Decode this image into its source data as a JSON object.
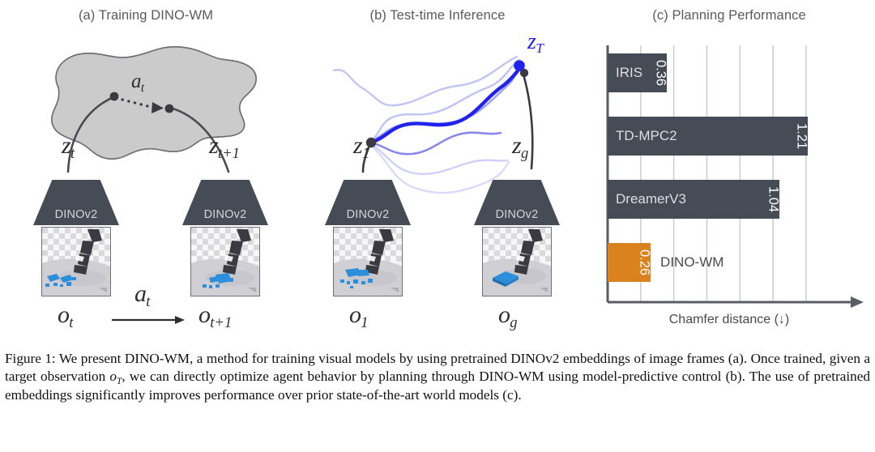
{
  "figure": {
    "caption_label": "Figure 1:",
    "caption_part1": " We present DINO-WM, a method for training visual models by using pretrained DINOv2 embeddings of image frames (a). Once trained, given a target observation ",
    "caption_math_base": "o",
    "caption_math_sub": "T",
    "caption_part2": ", we can directly optimize agent behavior by planning through DINO-WM using model-predictive control (b). The use of pretrained embeddings significantly improves performance over prior state-of-the-art world models (c)."
  },
  "panels": {
    "a": {
      "title": "(a) Training DINO-WM",
      "manifold_fill": "#cbcbcb",
      "manifold_stroke": "#6f6f74",
      "latent_labels": [
        {
          "base": "z",
          "sub": "t"
        },
        {
          "base": "z",
          "sub": "t+1"
        }
      ],
      "action_label": {
        "base": "a",
        "sub": "t"
      },
      "transition_arrow_label": {
        "base": "a",
        "sub": "t"
      },
      "encoders": [
        {
          "name": "DINOv2",
          "obs_base": "o",
          "obs_sub": "t",
          "thumb": "scattered-blue-granules"
        },
        {
          "name": "DINOv2",
          "obs_base": "o",
          "obs_sub": "t+1",
          "thumb": "scattered-blue-granules"
        }
      ]
    },
    "b": {
      "title": "(b) Test-time Inference",
      "start_label": {
        "base": "z",
        "sub": "1"
      },
      "goal_label": {
        "base": "z",
        "sub": "g"
      },
      "predicted_label": {
        "base": "z",
        "sub": "T"
      },
      "trajectory_color": "#2222ee",
      "candidate_color": "#8f90ef",
      "encoders": [
        {
          "name": "DINOv2",
          "obs_base": "o",
          "obs_sub": "1",
          "thumb": "scattered-blue-granules"
        },
        {
          "name": "DINOv2",
          "obs_base": "o",
          "obs_sub": "g",
          "thumb": "consolidated-blue-square"
        }
      ]
    },
    "c": {
      "title": "(c) Planning Performance"
    }
  },
  "chart_data": {
    "type": "bar",
    "orientation": "horizontal",
    "title": "(c) Planning Performance",
    "xlabel": "Chamfer distance (↓)",
    "ylabel": "",
    "categories": [
      "IRIS",
      "TD-MPC2",
      "DreamerV3",
      "DINO-WM"
    ],
    "values": [
      0.36,
      1.21,
      1.04,
      0.26
    ],
    "value_labels": [
      "0.36",
      "1.21",
      "1.04",
      "0.26"
    ],
    "label_inside": [
      true,
      true,
      true,
      false
    ],
    "bar_colors": [
      "#464c56",
      "#464c56",
      "#464c56",
      "#d9821e"
    ],
    "highlight_index": 3,
    "highlight_color": "#d9821e",
    "default_color": "#464c56",
    "xlim": [
      0,
      1.47
    ],
    "gridlines": [
      0.2,
      0.4,
      0.6,
      0.8,
      1.0,
      1.2
    ],
    "grid": true,
    "legend": "none",
    "axis_color": "#585d66",
    "grid_color": "#cfcfd3"
  }
}
